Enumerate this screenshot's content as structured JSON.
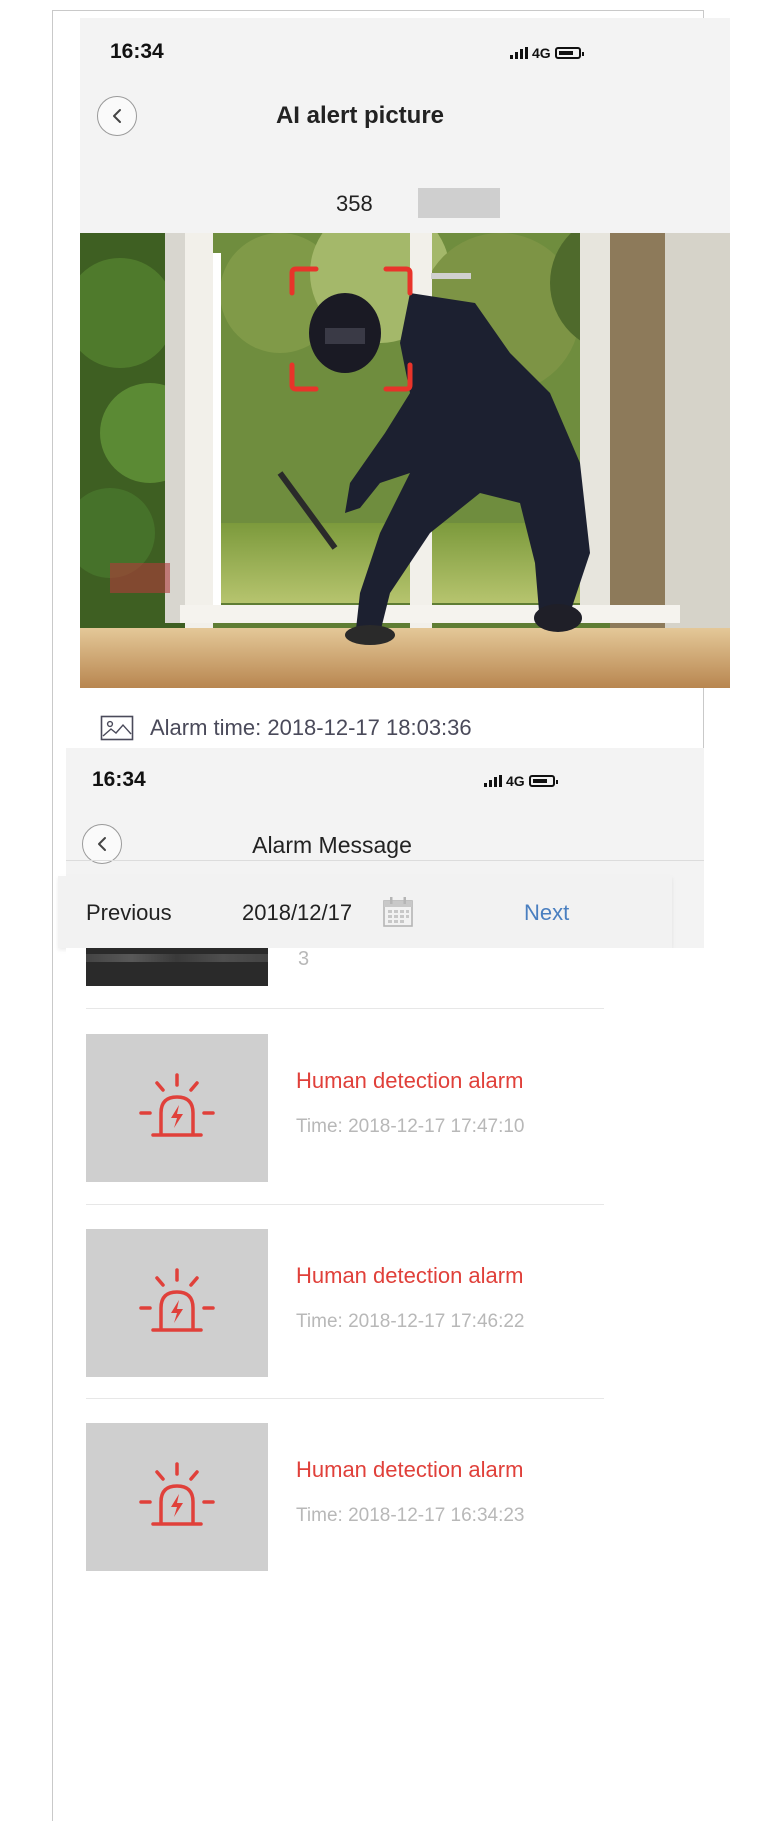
{
  "top_screen": {
    "status_time": "16:34",
    "network": "4G",
    "nav_title": "AI alert picture",
    "device_id": "358",
    "alarm_time": "Alarm time: 2018-12-17 18:03:36"
  },
  "bottom_screen": {
    "status_time": "16:34",
    "network": "4G",
    "nav_title": "Alarm Message",
    "previous_label": "Previous",
    "date": "2018/12/17",
    "next_label": "Next",
    "partial_item_time": "3",
    "items": [
      {
        "title": "Human detection alarm",
        "time": "Time: 2018-12-17 17:47:10"
      },
      {
        "title": "Human detection alarm",
        "time": "Time: 2018-12-17 17:46:22"
      },
      {
        "title": "Human detection alarm",
        "time": "Time: 2018-12-17 16:34:23"
      }
    ]
  },
  "colors": {
    "alarm_red": "#e0403a",
    "link_blue": "#4a7fc0",
    "header_gray": "#f3f3f3",
    "detection_box": "#e8342a"
  },
  "icons": [
    "back-icon",
    "signal-icon",
    "battery-icon",
    "picture-icon",
    "calendar-icon",
    "alarm-siren-icon"
  ]
}
